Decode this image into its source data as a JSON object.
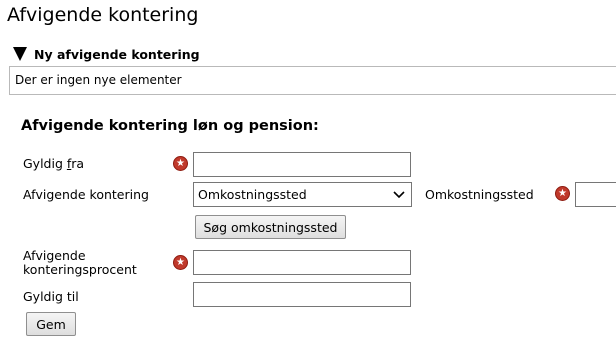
{
  "page": {
    "title": "Afvigende kontering"
  },
  "section": {
    "header": "Ny afvigende kontering",
    "empty_message": "Der er ingen nye elementer"
  },
  "form": {
    "title": "Afvigende kontering løn og pension:",
    "valid_from": {
      "label_prefix": "Gyldig ",
      "label_accesskey": "f",
      "label_suffix": "ra",
      "value": ""
    },
    "deviating_account": {
      "label": "Afvigende kontering",
      "selected": "Omkostningssted",
      "cost_center_label": "Omkostningssted",
      "cost_center_value": "",
      "search_button": "Søg omkostningssted"
    },
    "percentage": {
      "label_line1": "Afvigende",
      "label_line2": "konteringsprocent",
      "value": ""
    },
    "valid_to": {
      "label": "Gyldig til",
      "value": ""
    },
    "save_button": "Gem"
  },
  "colors": {
    "required_icon": "#c0392b",
    "border": "#767676"
  },
  "icons": {
    "required": "required-star-icon",
    "expand": "triangle-down-icon",
    "dropdown": "chevron-down-icon"
  }
}
